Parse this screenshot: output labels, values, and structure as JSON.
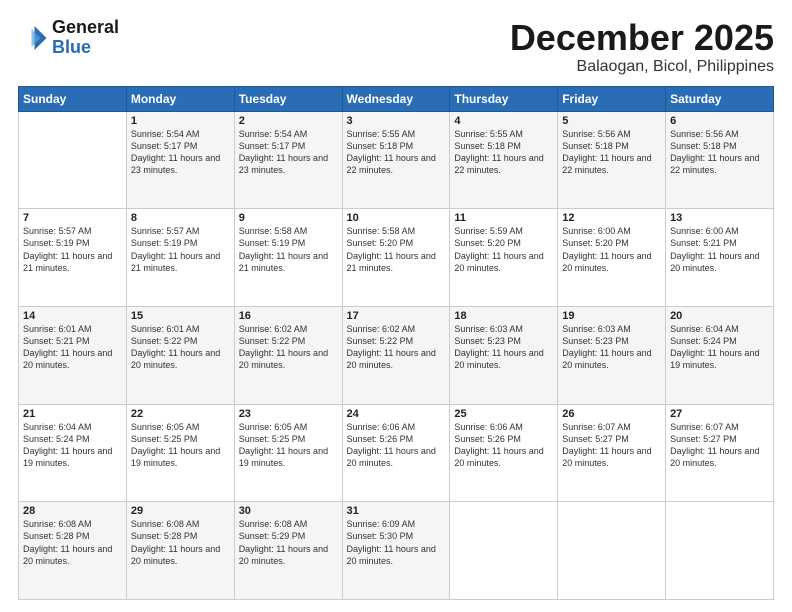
{
  "logo": {
    "line1": "General",
    "line2": "Blue"
  },
  "calendar": {
    "title": "December 2025",
    "subtitle": "Balaogan, Bicol, Philippines",
    "days_of_week": [
      "Sunday",
      "Monday",
      "Tuesday",
      "Wednesday",
      "Thursday",
      "Friday",
      "Saturday"
    ],
    "weeks": [
      [
        {
          "day": "",
          "sunrise": "",
          "sunset": "",
          "daylight": ""
        },
        {
          "day": "1",
          "sunrise": "Sunrise: 5:54 AM",
          "sunset": "Sunset: 5:17 PM",
          "daylight": "Daylight: 11 hours and 23 minutes."
        },
        {
          "day": "2",
          "sunrise": "Sunrise: 5:54 AM",
          "sunset": "Sunset: 5:17 PM",
          "daylight": "Daylight: 11 hours and 23 minutes."
        },
        {
          "day": "3",
          "sunrise": "Sunrise: 5:55 AM",
          "sunset": "Sunset: 5:18 PM",
          "daylight": "Daylight: 11 hours and 22 minutes."
        },
        {
          "day": "4",
          "sunrise": "Sunrise: 5:55 AM",
          "sunset": "Sunset: 5:18 PM",
          "daylight": "Daylight: 11 hours and 22 minutes."
        },
        {
          "day": "5",
          "sunrise": "Sunrise: 5:56 AM",
          "sunset": "Sunset: 5:18 PM",
          "daylight": "Daylight: 11 hours and 22 minutes."
        },
        {
          "day": "6",
          "sunrise": "Sunrise: 5:56 AM",
          "sunset": "Sunset: 5:18 PM",
          "daylight": "Daylight: 11 hours and 22 minutes."
        }
      ],
      [
        {
          "day": "7",
          "sunrise": "Sunrise: 5:57 AM",
          "sunset": "Sunset: 5:19 PM",
          "daylight": "Daylight: 11 hours and 21 minutes."
        },
        {
          "day": "8",
          "sunrise": "Sunrise: 5:57 AM",
          "sunset": "Sunset: 5:19 PM",
          "daylight": "Daylight: 11 hours and 21 minutes."
        },
        {
          "day": "9",
          "sunrise": "Sunrise: 5:58 AM",
          "sunset": "Sunset: 5:19 PM",
          "daylight": "Daylight: 11 hours and 21 minutes."
        },
        {
          "day": "10",
          "sunrise": "Sunrise: 5:58 AM",
          "sunset": "Sunset: 5:20 PM",
          "daylight": "Daylight: 11 hours and 21 minutes."
        },
        {
          "day": "11",
          "sunrise": "Sunrise: 5:59 AM",
          "sunset": "Sunset: 5:20 PM",
          "daylight": "Daylight: 11 hours and 20 minutes."
        },
        {
          "day": "12",
          "sunrise": "Sunrise: 6:00 AM",
          "sunset": "Sunset: 5:20 PM",
          "daylight": "Daylight: 11 hours and 20 minutes."
        },
        {
          "day": "13",
          "sunrise": "Sunrise: 6:00 AM",
          "sunset": "Sunset: 5:21 PM",
          "daylight": "Daylight: 11 hours and 20 minutes."
        }
      ],
      [
        {
          "day": "14",
          "sunrise": "Sunrise: 6:01 AM",
          "sunset": "Sunset: 5:21 PM",
          "daylight": "Daylight: 11 hours and 20 minutes."
        },
        {
          "day": "15",
          "sunrise": "Sunrise: 6:01 AM",
          "sunset": "Sunset: 5:22 PM",
          "daylight": "Daylight: 11 hours and 20 minutes."
        },
        {
          "day": "16",
          "sunrise": "Sunrise: 6:02 AM",
          "sunset": "Sunset: 5:22 PM",
          "daylight": "Daylight: 11 hours and 20 minutes."
        },
        {
          "day": "17",
          "sunrise": "Sunrise: 6:02 AM",
          "sunset": "Sunset: 5:22 PM",
          "daylight": "Daylight: 11 hours and 20 minutes."
        },
        {
          "day": "18",
          "sunrise": "Sunrise: 6:03 AM",
          "sunset": "Sunset: 5:23 PM",
          "daylight": "Daylight: 11 hours and 20 minutes."
        },
        {
          "day": "19",
          "sunrise": "Sunrise: 6:03 AM",
          "sunset": "Sunset: 5:23 PM",
          "daylight": "Daylight: 11 hours and 20 minutes."
        },
        {
          "day": "20",
          "sunrise": "Sunrise: 6:04 AM",
          "sunset": "Sunset: 5:24 PM",
          "daylight": "Daylight: 11 hours and 19 minutes."
        }
      ],
      [
        {
          "day": "21",
          "sunrise": "Sunrise: 6:04 AM",
          "sunset": "Sunset: 5:24 PM",
          "daylight": "Daylight: 11 hours and 19 minutes."
        },
        {
          "day": "22",
          "sunrise": "Sunrise: 6:05 AM",
          "sunset": "Sunset: 5:25 PM",
          "daylight": "Daylight: 11 hours and 19 minutes."
        },
        {
          "day": "23",
          "sunrise": "Sunrise: 6:05 AM",
          "sunset": "Sunset: 5:25 PM",
          "daylight": "Daylight: 11 hours and 19 minutes."
        },
        {
          "day": "24",
          "sunrise": "Sunrise: 6:06 AM",
          "sunset": "Sunset: 5:26 PM",
          "daylight": "Daylight: 11 hours and 20 minutes."
        },
        {
          "day": "25",
          "sunrise": "Sunrise: 6:06 AM",
          "sunset": "Sunset: 5:26 PM",
          "daylight": "Daylight: 11 hours and 20 minutes."
        },
        {
          "day": "26",
          "sunrise": "Sunrise: 6:07 AM",
          "sunset": "Sunset: 5:27 PM",
          "daylight": "Daylight: 11 hours and 20 minutes."
        },
        {
          "day": "27",
          "sunrise": "Sunrise: 6:07 AM",
          "sunset": "Sunset: 5:27 PM",
          "daylight": "Daylight: 11 hours and 20 minutes."
        }
      ],
      [
        {
          "day": "28",
          "sunrise": "Sunrise: 6:08 AM",
          "sunset": "Sunset: 5:28 PM",
          "daylight": "Daylight: 11 hours and 20 minutes."
        },
        {
          "day": "29",
          "sunrise": "Sunrise: 6:08 AM",
          "sunset": "Sunset: 5:28 PM",
          "daylight": "Daylight: 11 hours and 20 minutes."
        },
        {
          "day": "30",
          "sunrise": "Sunrise: 6:08 AM",
          "sunset": "Sunset: 5:29 PM",
          "daylight": "Daylight: 11 hours and 20 minutes."
        },
        {
          "day": "31",
          "sunrise": "Sunrise: 6:09 AM",
          "sunset": "Sunset: 5:30 PM",
          "daylight": "Daylight: 11 hours and 20 minutes."
        },
        {
          "day": "",
          "sunrise": "",
          "sunset": "",
          "daylight": ""
        },
        {
          "day": "",
          "sunrise": "",
          "sunset": "",
          "daylight": ""
        },
        {
          "day": "",
          "sunrise": "",
          "sunset": "",
          "daylight": ""
        }
      ]
    ]
  }
}
